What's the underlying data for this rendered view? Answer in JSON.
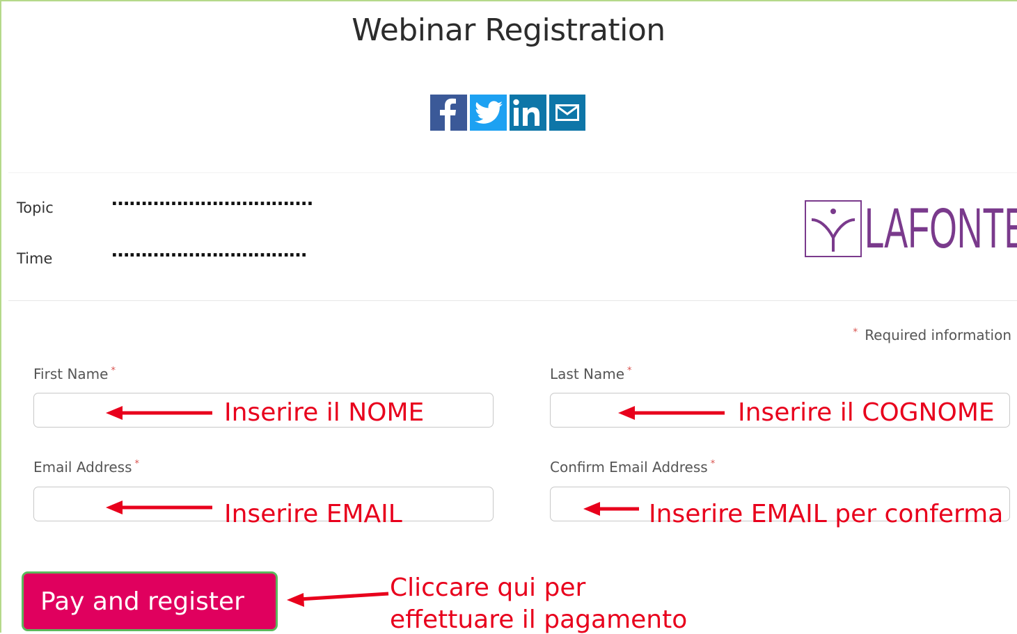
{
  "page": {
    "title": "Webinar Registration"
  },
  "social": [
    {
      "name": "facebook-icon",
      "glyph": "f"
    },
    {
      "name": "twitter-icon",
      "glyph": "bird"
    },
    {
      "name": "linkedin-icon",
      "glyph": "in"
    },
    {
      "name": "email-icon",
      "glyph": "envelope"
    }
  ],
  "info": {
    "topic_label": "Topic",
    "topic_value": "…………………………….",
    "time_label": "Time",
    "time_value": "……………………………"
  },
  "logo": {
    "text": "LAFONTE",
    "color": "#7a3a8c"
  },
  "form": {
    "required_note": "Required information",
    "required_mark": "*",
    "first_name_label": "First Name",
    "last_name_label": "Last Name",
    "email_label": "Email Address",
    "confirm_email_label": "Confirm Email Address",
    "submit_label": "Pay and register"
  },
  "annotations": {
    "first_name": "Inserire il NOME",
    "last_name": "Inserire il COGNOME",
    "email": "Inserire EMAIL",
    "confirm_email": "Inserire EMAIL per conferma",
    "submit_line1": "Cliccare qui per",
    "submit_line2": "effettuare il pagamento",
    "color": "#e8001c"
  },
  "colors": {
    "button": "#e0005e",
    "button_border": "#5cb85c",
    "frame": "#b5d98a"
  }
}
